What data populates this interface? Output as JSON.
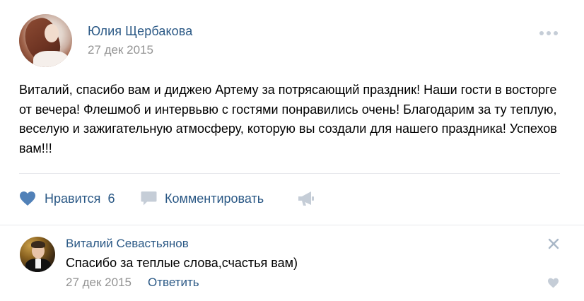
{
  "post": {
    "author": "Юлия Щербакова",
    "date": "27 дек 2015",
    "text": "Виталий, спасибо вам и диджею Артему за потрясающий праздник! Наши гости в восторге от вечера! Флешмоб и интервьвю с гостями понравились очень! Благодарим за ту теплую, веселую и зажигательную атмосферу, которую вы создали для нашего праздника! Успехов вам!!!"
  },
  "actions": {
    "like_label": "Нравится",
    "like_count": "6",
    "comment_label": "Комментировать",
    "share_icon": "megaphone-icon"
  },
  "reply": {
    "author": "Виталий Севастьянов",
    "text": "Спасибо за теплые слова,счастья вам)",
    "date": "27 дек 2015",
    "action_label": "Ответить"
  },
  "colors": {
    "link": "#2a5885",
    "muted": "#939393",
    "icon": "#5181b8",
    "icon_muted": "#c5cdd7"
  }
}
